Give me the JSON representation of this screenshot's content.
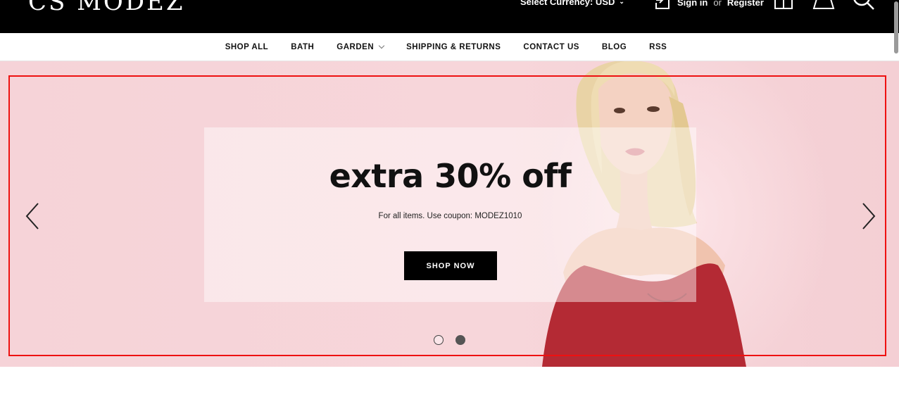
{
  "header": {
    "logo_text": "CS MODEZ",
    "currency_label": "Select Currency: USD",
    "sign_in": "Sign in",
    "or": "or",
    "register": "Register",
    "icons": [
      "sign-in-icon",
      "gift-icon",
      "bag-icon",
      "search-icon"
    ]
  },
  "nav": {
    "items": [
      {
        "label": "SHOP ALL"
      },
      {
        "label": "BATH"
      },
      {
        "label": "GARDEN",
        "has_dropdown": true
      },
      {
        "label": "SHIPPING & RETURNS"
      },
      {
        "label": "CONTACT US"
      },
      {
        "label": "BLOG"
      },
      {
        "label": "RSS"
      }
    ]
  },
  "hero": {
    "title": "extra 30% off",
    "subtitle": "For all items. Use coupon: MODEZ1010",
    "button_label": "SHOP NOW",
    "slides_count": 2,
    "active_slide": 2,
    "colors": {
      "background": "#f6d3d8",
      "button": "#000000",
      "highlight": "#ee1111",
      "top": "#b42a34"
    }
  }
}
